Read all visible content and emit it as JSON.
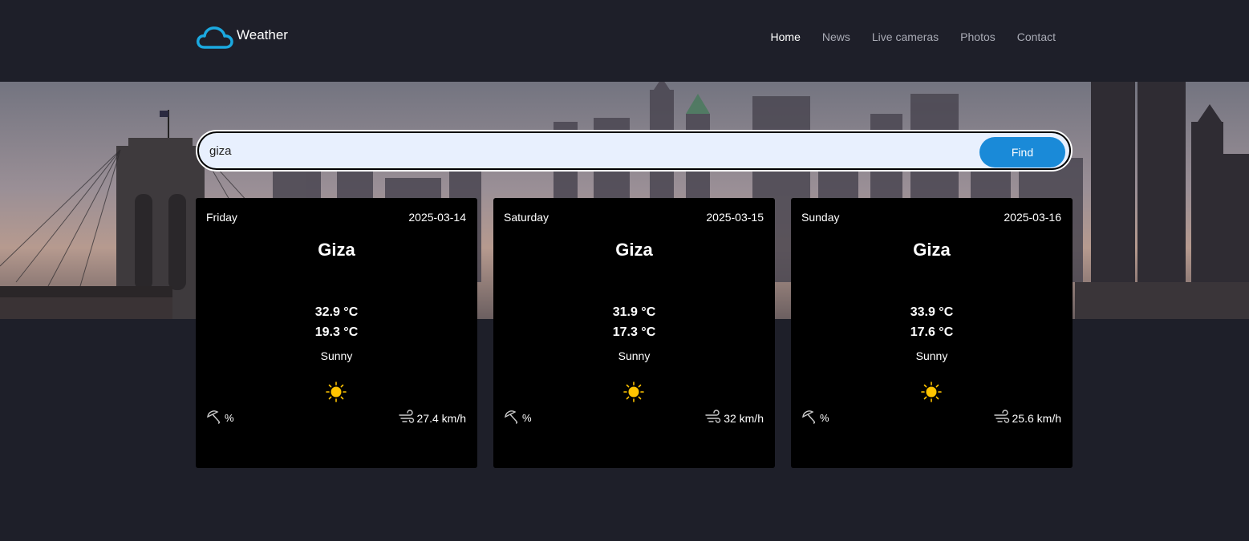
{
  "brand": {
    "name": "Weather",
    "icon": "cloud-icon",
    "color": "#1ba9e0"
  },
  "nav": [
    {
      "label": "Home",
      "active": true
    },
    {
      "label": "News",
      "active": false
    },
    {
      "label": "Live cameras",
      "active": false
    },
    {
      "label": "Photos",
      "active": false
    },
    {
      "label": "Contact",
      "active": false
    }
  ],
  "search": {
    "value": "giza",
    "button_label": "Find"
  },
  "forecast": [
    {
      "day": "Friday",
      "date": "2025-03-14",
      "city": "Giza",
      "max_temp": "32.9 °C",
      "min_temp": "19.3 °C",
      "condition": "Sunny",
      "rain": "%",
      "wind": "27.4 km/h",
      "icon": "sun-icon"
    },
    {
      "day": "Saturday",
      "date": "2025-03-15",
      "city": "Giza",
      "max_temp": "31.9 °C",
      "min_temp": "17.3 °C",
      "condition": "Sunny",
      "rain": "%",
      "wind": "32 km/h",
      "icon": "sun-icon"
    },
    {
      "day": "Sunday",
      "date": "2025-03-16",
      "city": "Giza",
      "max_temp": "33.9 °C",
      "min_temp": "17.6 °C",
      "condition": "Sunny",
      "rain": "%",
      "wind": "25.6 km/h",
      "icon": "sun-icon"
    }
  ],
  "colors": {
    "background": "#1e1f29",
    "card": "#000000",
    "accent": "#1a8ad8",
    "sun": "#ffc400"
  }
}
